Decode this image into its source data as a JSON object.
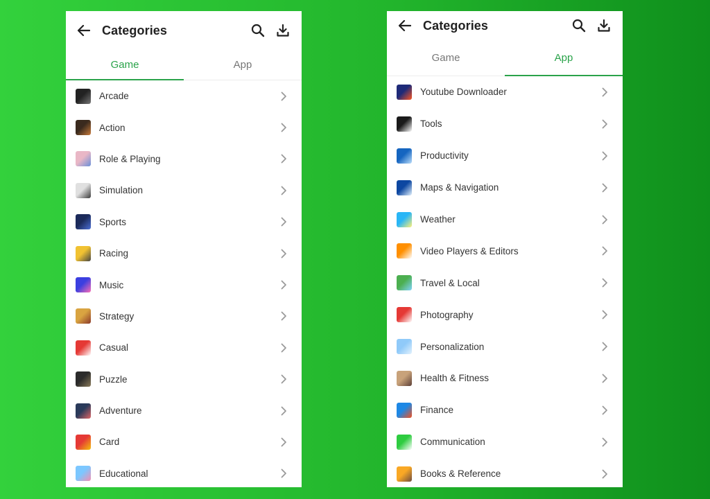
{
  "left": {
    "title": "Categories",
    "tabs": [
      {
        "label": "Game",
        "active": true
      },
      {
        "label": "App",
        "active": false
      }
    ],
    "items": [
      {
        "label": "Arcade",
        "icon": "arcade-icon",
        "colors": [
          "#222222",
          "#777777"
        ]
      },
      {
        "label": "Action",
        "icon": "action-icon",
        "colors": [
          "#3a2a1e",
          "#c97b3a"
        ]
      },
      {
        "label": "Role & Playing",
        "icon": "role-playing-icon",
        "colors": [
          "#e9b7c6",
          "#6a8fd8"
        ]
      },
      {
        "label": "Simulation",
        "icon": "simulation-icon",
        "colors": [
          "#e0e0e0",
          "#3a3a3a"
        ]
      },
      {
        "label": "Sports",
        "icon": "sports-icon",
        "colors": [
          "#1b2a5a",
          "#4c6fd6"
        ]
      },
      {
        "label": "Racing",
        "icon": "racing-icon",
        "colors": [
          "#f1c232",
          "#444444"
        ]
      },
      {
        "label": "Music",
        "icon": "music-icon",
        "colors": [
          "#3b3fe0",
          "#ff6fb5"
        ]
      },
      {
        "label": "Strategy",
        "icon": "strategy-icon",
        "colors": [
          "#d9a441",
          "#8b3a2a"
        ]
      },
      {
        "label": "Casual",
        "icon": "casual-icon",
        "colors": [
          "#e53935",
          "#ffffff"
        ]
      },
      {
        "label": "Puzzle",
        "icon": "puzzle-icon",
        "colors": [
          "#2b2b2b",
          "#8a7a5a"
        ]
      },
      {
        "label": "Adventure",
        "icon": "adventure-icon",
        "colors": [
          "#2a3a5a",
          "#e06666"
        ]
      },
      {
        "label": "Card",
        "icon": "card-icon",
        "colors": [
          "#e53935",
          "#f4c20d"
        ]
      },
      {
        "label": "Educational",
        "icon": "educational-icon",
        "colors": [
          "#7cc7ff",
          "#f48fb1"
        ]
      }
    ]
  },
  "right": {
    "title": "Categories",
    "tabs": [
      {
        "label": "Game",
        "active": false
      },
      {
        "label": "App",
        "active": true
      }
    ],
    "items": [
      {
        "label": "Youtube Downloader",
        "icon": "youtube-downloader-icon",
        "colors": [
          "#1e2a78",
          "#ff5722"
        ]
      },
      {
        "label": "Tools",
        "icon": "tools-icon",
        "colors": [
          "#1a1a1a",
          "#ffffff"
        ]
      },
      {
        "label": "Productivity",
        "icon": "productivity-icon",
        "colors": [
          "#1565c0",
          "#bbdefb"
        ]
      },
      {
        "label": "Maps & Navigation",
        "icon": "maps-navigation-icon",
        "colors": [
          "#0d47a1",
          "#e3f2fd"
        ]
      },
      {
        "label": "Weather",
        "icon": "weather-icon",
        "colors": [
          "#29b6f6",
          "#fff176"
        ]
      },
      {
        "label": "Video Players & Editors",
        "icon": "video-players-icon",
        "colors": [
          "#ff8f00",
          "#ffffff"
        ]
      },
      {
        "label": "Travel & Local",
        "icon": "travel-local-icon",
        "colors": [
          "#4caf50",
          "#81d4fa"
        ]
      },
      {
        "label": "Photography",
        "icon": "photography-icon",
        "colors": [
          "#e53935",
          "#ffffff"
        ]
      },
      {
        "label": "Personalization",
        "icon": "personalization-icon",
        "colors": [
          "#90caf9",
          "#e3f2fd"
        ]
      },
      {
        "label": "Health & Fitness",
        "icon": "health-fitness-icon",
        "colors": [
          "#c8a27a",
          "#5d4037"
        ]
      },
      {
        "label": "Finance",
        "icon": "finance-icon",
        "colors": [
          "#1e88e5",
          "#f4511e"
        ]
      },
      {
        "label": "Communication",
        "icon": "communication-icon",
        "colors": [
          "#2ecc40",
          "#ffffff"
        ]
      },
      {
        "label": "Books & Reference",
        "icon": "books-reference-icon",
        "colors": [
          "#f9a825",
          "#6d4c41"
        ]
      }
    ]
  },
  "accent_color": "#2aa34a"
}
